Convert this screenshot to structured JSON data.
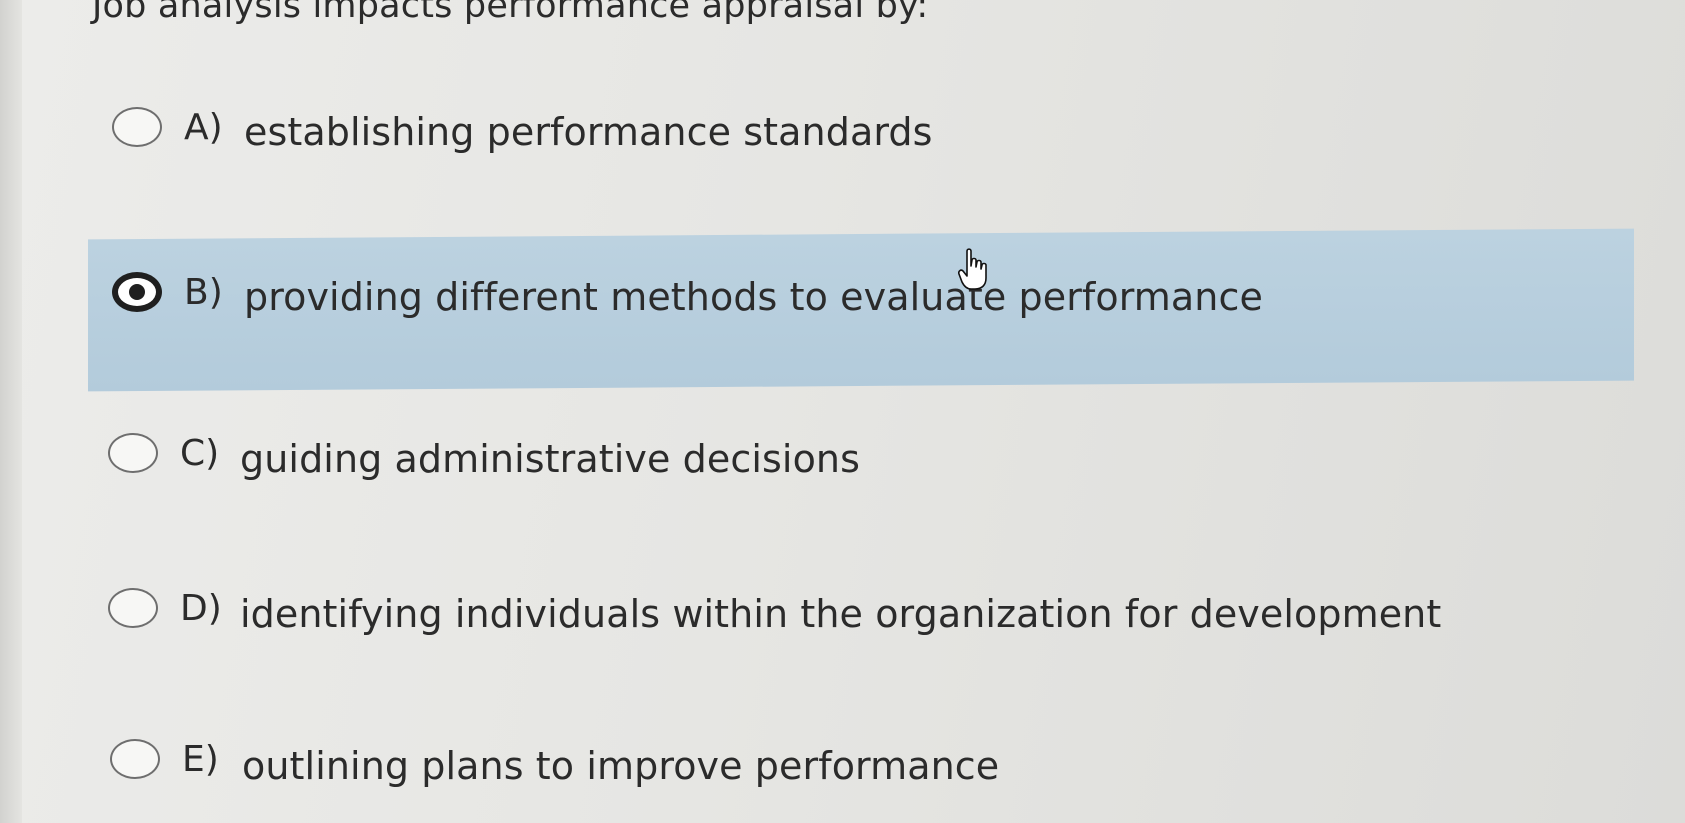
{
  "question": "Job analysis impacts performance appraisal by:",
  "options": [
    {
      "letter": "A)",
      "text": "establishing performance standards",
      "selected": false
    },
    {
      "letter": "B)",
      "text": "providing different methods to evaluate performance",
      "selected": true
    },
    {
      "letter": "C)",
      "text": "guiding administrative decisions",
      "selected": false
    },
    {
      "letter": "D)",
      "text": "identifying individuals within the organization for development",
      "selected": false
    },
    {
      "letter": "E)",
      "text": "outlining plans to improve performance",
      "selected": false
    }
  ],
  "colors": {
    "selected_highlight": "#b7cedd",
    "text": "#2b2b2b"
  },
  "cursor_icon": "hand-pointer-icon"
}
